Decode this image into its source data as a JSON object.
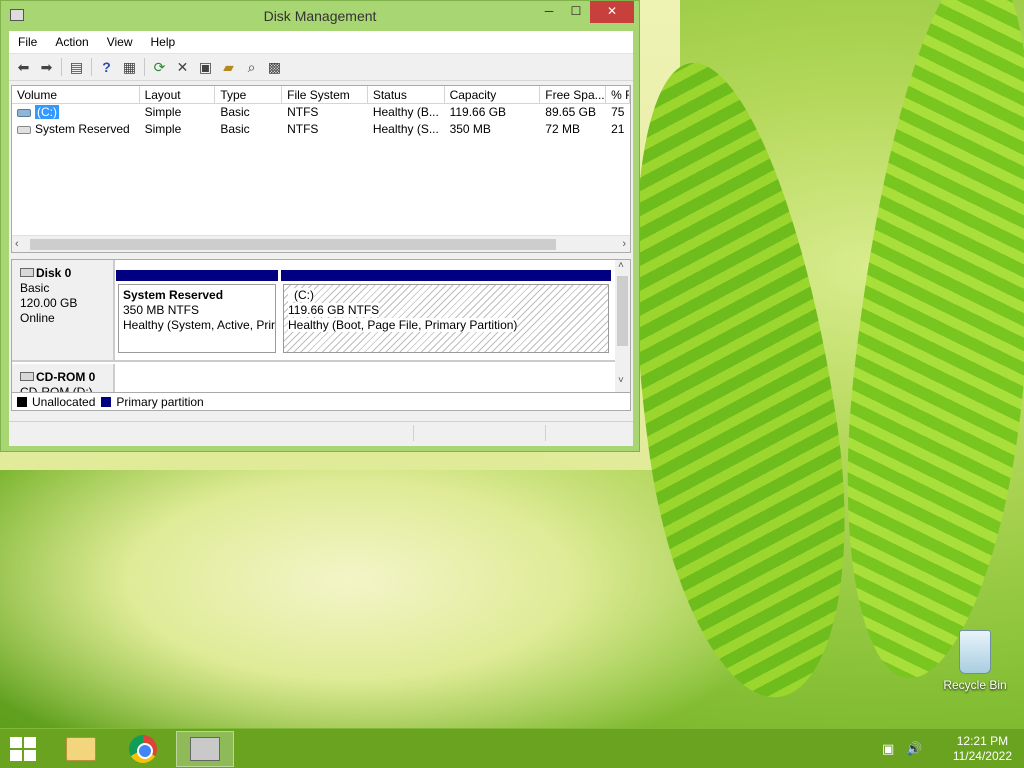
{
  "window": {
    "title": "Disk Management",
    "min_glyph": "─",
    "max_glyph": "☐",
    "close_glyph": "✕"
  },
  "menu": [
    "File",
    "Action",
    "View",
    "Help"
  ],
  "toolbar_icons": [
    "back-icon",
    "forward-icon",
    "show-hide-console-tree-icon",
    "help-icon",
    "properties-pane-icon",
    "refresh-icon",
    "delete-icon",
    "properties-icon",
    "open-icon",
    "search-icon",
    "disk-settings-icon"
  ],
  "volume_list": {
    "columns": [
      "Volume",
      "Layout",
      "Type",
      "File System",
      "Status",
      "Capacity",
      "Free Spa...",
      "% F"
    ],
    "rows": [
      {
        "volume": "(C:)",
        "layout": "Simple",
        "type": "Basic",
        "fs": "NTFS",
        "status": "Healthy (B...",
        "capacity": "119.66 GB",
        "free": "89.65 GB",
        "pct": "75"
      },
      {
        "volume": "System Reserved",
        "layout": "Simple",
        "type": "Basic",
        "fs": "NTFS",
        "status": "Healthy (S...",
        "capacity": "350 MB",
        "free": "72 MB",
        "pct": "21"
      }
    ]
  },
  "disk0": {
    "name": "Disk 0",
    "type": "Basic",
    "size": "120.00 GB",
    "state": "Online",
    "partitions": [
      {
        "name": "System Reserved",
        "size": "350 MB NTFS",
        "status": "Healthy (System, Active, Prir"
      },
      {
        "name": "(C:)",
        "size": "119.66 GB NTFS",
        "status": "Healthy (Boot, Page File, Primary Partition)"
      }
    ]
  },
  "cdrom0": {
    "name": "CD-ROM 0",
    "drive": "CD-ROM (D:)"
  },
  "legend": [
    {
      "label": "Unallocated",
      "color": "#000000"
    },
    {
      "label": "Primary partition",
      "color": "#000080"
    }
  ],
  "desktop": {
    "recycle_bin": "Recycle Bin"
  },
  "taskbar": {
    "time": "12:21 PM",
    "date": "11/24/2022"
  },
  "colors": {
    "partition_bar": "#000080",
    "close_button": "#c7403b",
    "selection": "#3399ff"
  }
}
